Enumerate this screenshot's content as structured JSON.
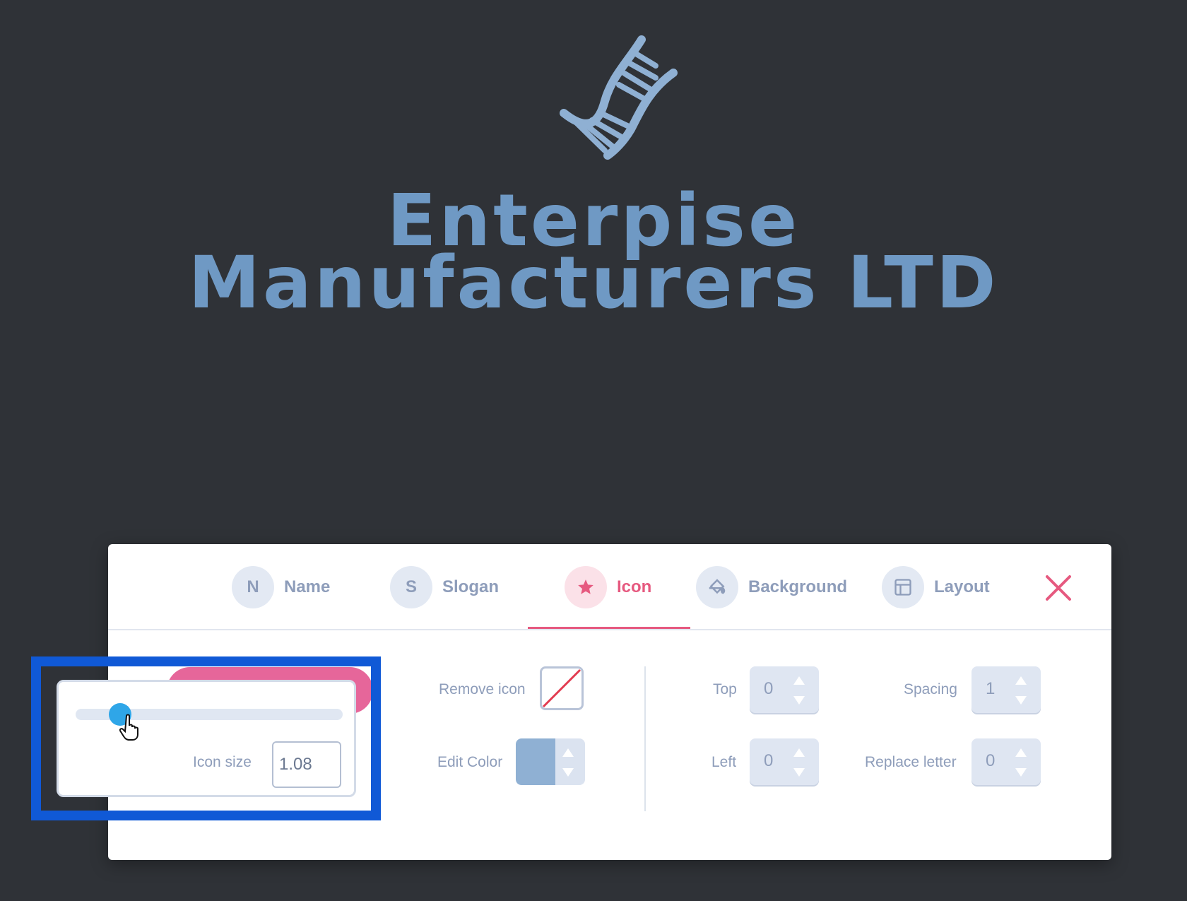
{
  "logo": {
    "icon": "dna-icon",
    "name_line1": "Enterpise",
    "name_line2": "Manufacturers LTD",
    "text_color": "#6f99c4"
  },
  "tabs": [
    {
      "letter": "N",
      "label": "Name",
      "icon": "letter-circle",
      "active": false
    },
    {
      "letter": "S",
      "label": "Slogan",
      "icon": "letter-circle",
      "active": false
    },
    {
      "letter": "",
      "label": "Icon",
      "icon": "star-icon",
      "active": true
    },
    {
      "letter": "",
      "label": "Background",
      "icon": "paint-bucket-icon",
      "active": false
    },
    {
      "letter": "",
      "label": "Layout",
      "icon": "layout-icon",
      "active": false
    }
  ],
  "icon_settings": {
    "remove_icon_label": "Remove icon",
    "edit_color_label": "Edit Color",
    "icon_color": "#8fb0d3",
    "top_label": "Top",
    "top_value": "0",
    "left_label": "Left",
    "left_value": "0",
    "spacing_label": "Spacing",
    "spacing_value": "1",
    "replace_letter_label": "Replace letter",
    "replace_letter_value": "0"
  },
  "icon_size_popover": {
    "label": "Icon size",
    "value": "1.08",
    "slider_fraction": 0.17
  },
  "colors": {
    "accent": "#e6597f",
    "slider_thumb": "#2fa6e8",
    "highlight": "#1059d6",
    "background": "#2f3237"
  }
}
